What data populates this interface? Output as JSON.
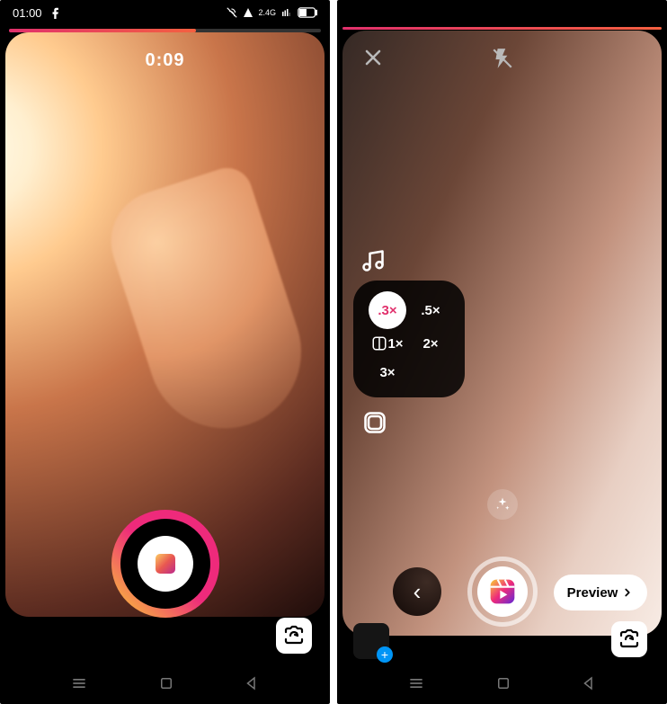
{
  "left": {
    "status": {
      "time": "01:00",
      "app_icon": "facebook"
    },
    "timer": "0:09",
    "record_button": "recording",
    "flip_camera": "flip",
    "progress_pct": 60
  },
  "right": {
    "close": "close",
    "flash": "flash-off",
    "music": "music",
    "speed": {
      "options": [
        ".3×",
        ".5×",
        "1×",
        "2×",
        "3×"
      ],
      "selected": ".3×"
    },
    "layout": "layout",
    "sparkle": "effects",
    "last_clip_arrow": "‹",
    "reels_button": "reels",
    "preview": "Preview",
    "add_clip_plus": "+",
    "flip_camera": "flip"
  },
  "nav": {
    "recents": "recents",
    "home": "home",
    "back": "back"
  }
}
